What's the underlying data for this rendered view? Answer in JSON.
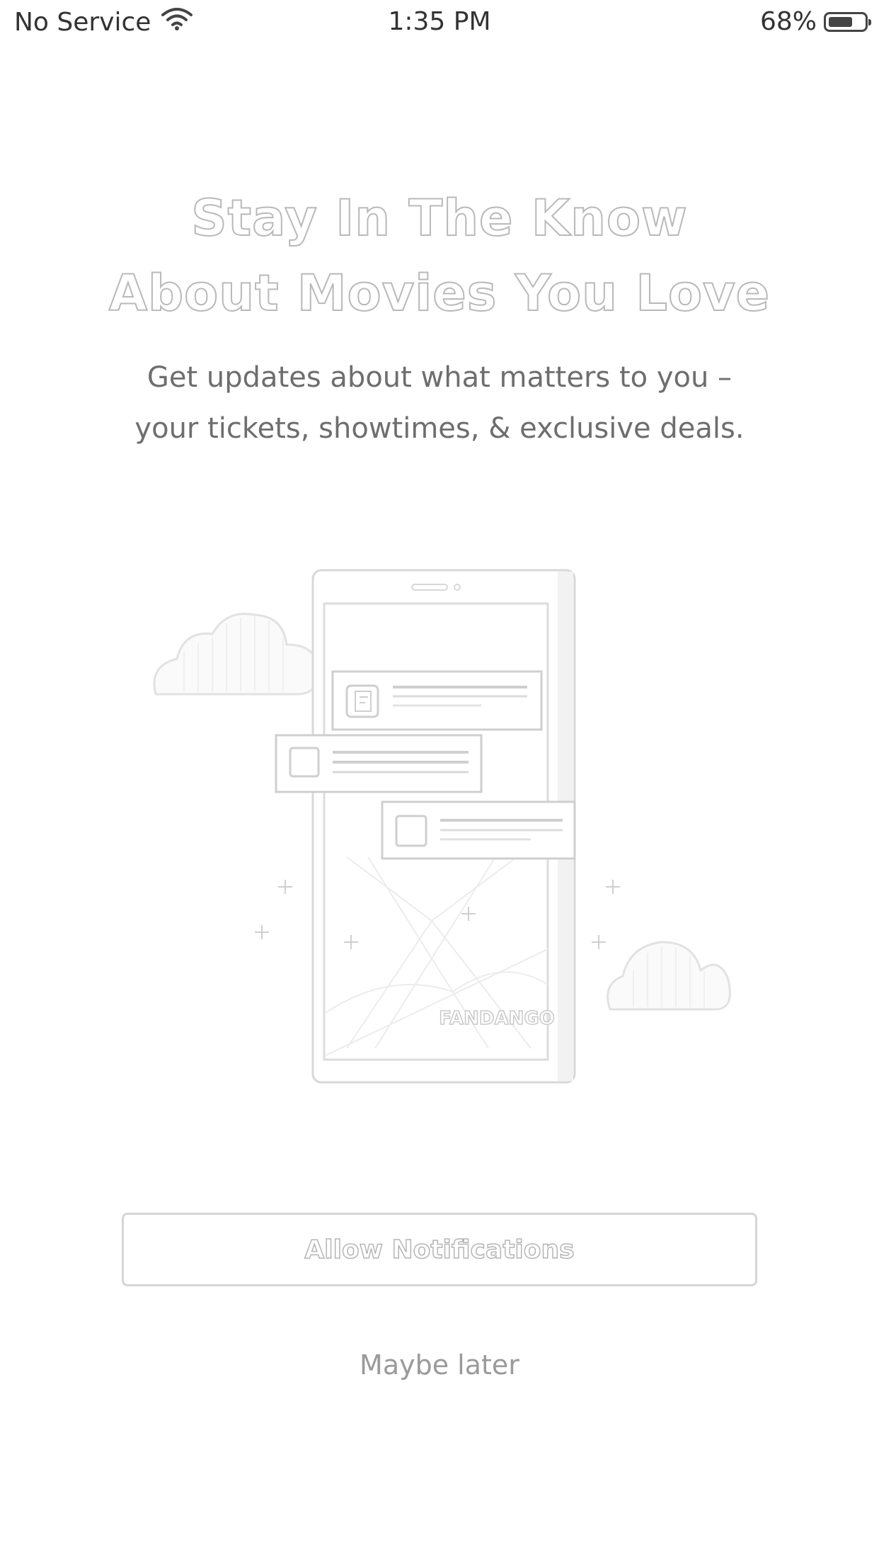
{
  "status_bar": {
    "carrier": "No Service",
    "time": "1:35 PM",
    "battery_percent": "68%",
    "battery_level": 0.68,
    "icons": [
      "wifi-icon",
      "battery-icon"
    ]
  },
  "onboarding": {
    "title_line1": "Stay In The Know",
    "title_line2": "About Movies You Love",
    "subtitle_line1": "Get updates about what matters to you –",
    "subtitle_line2": "your tickets, showtimes, & exclusive deals.",
    "illustration": {
      "brand_text": "FANDANGO",
      "icons": [
        "phone-icon",
        "cloud-icon",
        "notification-card-icon",
        "sparkle-icon"
      ]
    }
  },
  "actions": {
    "allow_label": "Allow Notifications",
    "later_label": "Maybe later"
  },
  "colors": {
    "outline": "#bdbdbd",
    "text": "#6e6e6e",
    "background": "#ffffff"
  }
}
